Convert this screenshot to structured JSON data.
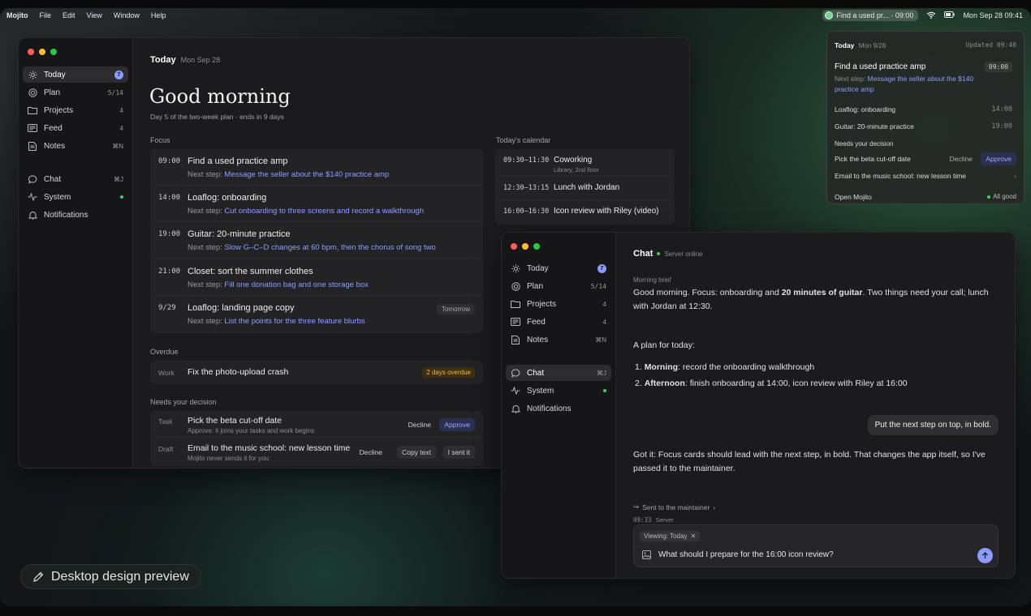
{
  "menubar": {
    "app": "Mojito",
    "menus": [
      "File",
      "Edit",
      "View",
      "Window",
      "Help"
    ],
    "status_pill": "Find a used pr... · 09:00",
    "clock": "Mon Sep 28  09:41"
  },
  "popover": {
    "header_title": "Today",
    "header_date": "Mon 9/28",
    "updated": "Updated 09:40",
    "focus_title": "Find a used practice amp",
    "focus_time": "09:00",
    "focus_next_label": "Next step:",
    "focus_next": "Message the seller about the $140 practice amp",
    "items": [
      {
        "title": "Loaflog: onboarding",
        "time": "14:00"
      },
      {
        "title": "Guitar: 20-minute practice",
        "time": "19:00"
      }
    ],
    "decision_label": "Needs your decision",
    "decision_1": "Pick the beta cut-off date",
    "decline": "Decline",
    "approve": "Approve",
    "decision_2": "Email to the music school: new lesson time",
    "open": "Open Mojito",
    "status": "All good"
  },
  "sidebar": {
    "items": [
      {
        "label": "Today",
        "meta": "7"
      },
      {
        "label": "Plan",
        "meta": "5/14"
      },
      {
        "label": "Projects",
        "meta": "4"
      },
      {
        "label": "Feed",
        "meta": "4"
      },
      {
        "label": "Notes",
        "meta": "⌘N"
      },
      {
        "label": "Chat",
        "meta": "⌘J"
      },
      {
        "label": "System",
        "meta": ""
      },
      {
        "label": "Notifications",
        "meta": ""
      }
    ]
  },
  "today": {
    "header_title": "Today",
    "header_date": "Mon Sep 28",
    "greeting": "Good morning",
    "subtitle": "Day 5 of the two-week plan · ends in 9 days",
    "focus_label": "Focus",
    "next_label": "Next step:",
    "focus": [
      {
        "time": "09:00",
        "title": "Find a used practice amp",
        "next": "Message the seller about the $140 practice amp"
      },
      {
        "time": "14:00",
        "title": "Loaflog: onboarding",
        "next": "Cut onboarding to three screens and record a walkthrough"
      },
      {
        "time": "19:00",
        "title": "Guitar: 20-minute practice",
        "next": "Slow G–C–D changes at 60 bpm, then the chorus of song two"
      },
      {
        "time": "21:00",
        "title": "Closet: sort the summer clothes",
        "next": "Fill one donation bag and one storage box"
      },
      {
        "time": "9/29",
        "title": "Loaflog: landing page copy",
        "next": "List the points for the three feature blurbs",
        "tag": "Tomorrow"
      }
    ],
    "overdue_label": "Overdue",
    "overdue": {
      "kind": "Work",
      "title": "Fix the photo-upload crash",
      "badge": "2 days overdue"
    },
    "decision_label": "Needs your decision",
    "decisions": [
      {
        "kind": "Task",
        "title": "Pick the beta cut-off date",
        "sub": "Approve: it joins your tasks and work begins",
        "btn1": "Decline",
        "btn2": "Approve"
      },
      {
        "kind": "Draft",
        "title": "Email to the music school: new lesson time",
        "sub": "Mojito never sends it for you",
        "btn1": "Decline",
        "btn2": "Copy text",
        "btn3": "I sent it"
      }
    ],
    "calendar_label": "Today's calendar",
    "calendar": [
      {
        "time": "09:30–11:30",
        "title": "Coworking",
        "sub": "Library, 2nd floor"
      },
      {
        "time": "12:30–13:15",
        "title": "Lunch with Jordan",
        "sub": ""
      },
      {
        "time": "16:00–16:30",
        "title": "Icon review with Riley (video)",
        "sub": ""
      }
    ]
  },
  "chat": {
    "title": "Chat",
    "status": "Server online",
    "brief_label": "Morning brief",
    "msg1_a": "Good morning. Focus: onboarding and ",
    "msg1_b": "20 minutes of guitar",
    "msg1_c": ". Two things need your call; lunch with Jordan at 12:30.",
    "plan_intro": "A plan for today:",
    "plan": [
      {
        "n": "1.",
        "bold": "Morning",
        "rest": ": record the onboarding walkthrough"
      },
      {
        "n": "2.",
        "bold": "Afternoon",
        "rest": ": finish onboarding at 14:00, icon review with Riley at 16:00"
      }
    ],
    "user_msg": "Put the next step on top, in bold.",
    "reply": "Got it: Focus cards should lead with the next step, in bold. That changes the app itself, so I've passed it to the maintainer.",
    "sent_to": "Sent to the maintainer",
    "meta_time": "09:33",
    "meta_source": "Server",
    "context_chip": "Viewing: Today",
    "input_value": "What should I prepare for the 16:00 icon review?"
  },
  "preview_label": "Desktop design preview",
  "colors": {
    "accent": "#8b9bff",
    "online": "#3ecf6b",
    "overdue": "#f1b73a"
  }
}
